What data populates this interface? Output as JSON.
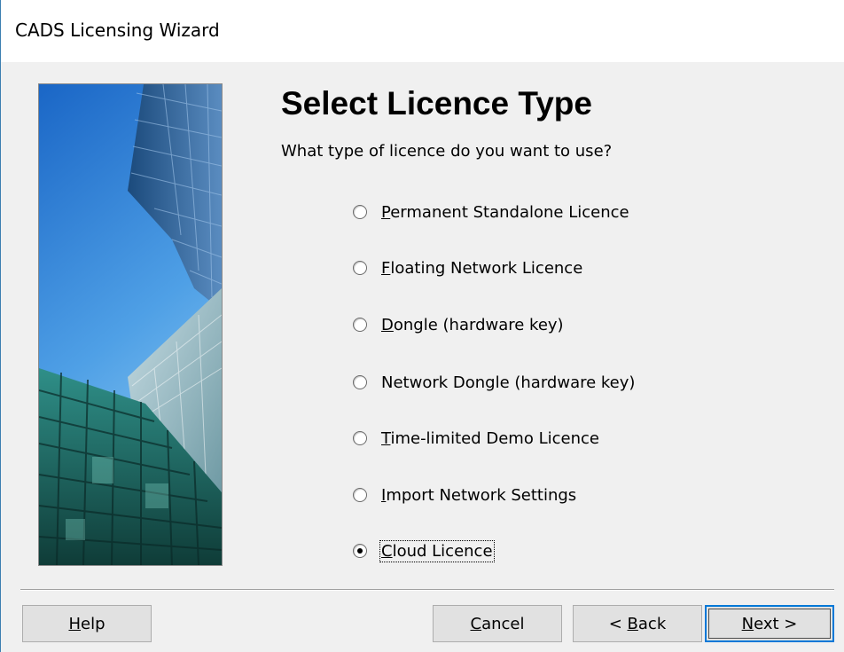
{
  "window": {
    "title": "CADS Licensing Wizard"
  },
  "page": {
    "heading": "Select Licence Type",
    "question": "What type of licence do you want to use?"
  },
  "options": [
    {
      "acc": "P",
      "rest": "ermanent Standalone Licence",
      "selected": false
    },
    {
      "acc": "F",
      "rest": "loating Network Licence",
      "selected": false
    },
    {
      "acc": "D",
      "rest": "ongle (hardware key)",
      "selected": false
    },
    {
      "acc": "",
      "rest": "Network Dongle (hardware key)",
      "selected": false
    },
    {
      "acc": "T",
      "rest": "ime-limited Demo Licence",
      "selected": false
    },
    {
      "acc": "I",
      "rest": "mport Network Settings",
      "selected": false
    },
    {
      "acc": "C",
      "rest": "loud Licence",
      "selected": true
    }
  ],
  "buttons": {
    "help": {
      "acc": "H",
      "rest": "elp"
    },
    "cancel": {
      "acc": "C",
      "rest": "ancel"
    },
    "back": {
      "pre": "< ",
      "acc": "B",
      "rest": "ack"
    },
    "next": {
      "acc": "N",
      "rest": "ext >"
    }
  },
  "image": {
    "icon": "building-photo",
    "sky_color": "#3a86d4",
    "glass_color": "#1f7a78"
  }
}
